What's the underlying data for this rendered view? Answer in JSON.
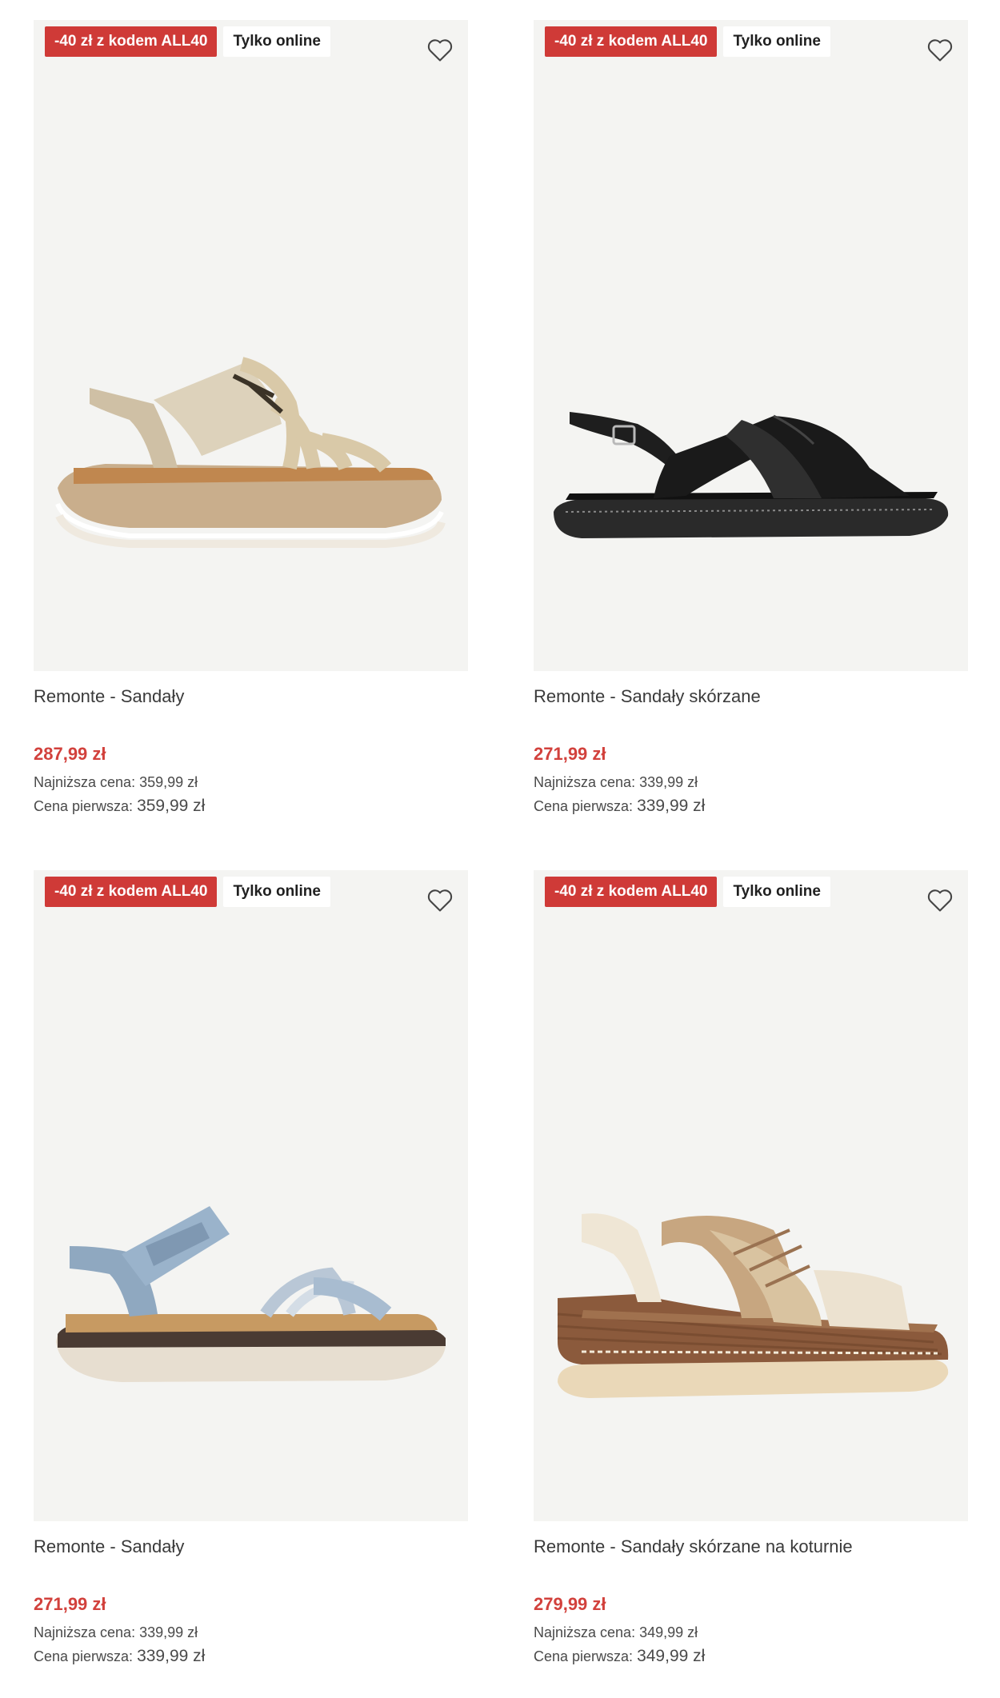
{
  "products": [
    {
      "promo_badge": "-40 zł z kodem ALL40",
      "online_badge": "Tylko online",
      "title": "Remonte - Sandały",
      "price": "287,99 zł",
      "lowest_label": "Najniższa cena:",
      "lowest_value": "359,99 zł",
      "first_label": "Cena pierwsza:",
      "first_value": "359,99 zł",
      "image": "beige-strappy-platform-sandal"
    },
    {
      "promo_badge": "-40 zł z kodem ALL40",
      "online_badge": "Tylko online",
      "title": "Remonte - Sandały skórzane",
      "price": "271,99 zł",
      "lowest_label": "Najniższa cena:",
      "lowest_value": "339,99 zł",
      "first_label": "Cena pierwsza:",
      "first_value": "339,99 zł",
      "image": "black-leather-crossover-sandal"
    },
    {
      "promo_badge": "-40 zł z kodem ALL40",
      "online_badge": "Tylko online",
      "title": "Remonte - Sandały",
      "price": "271,99 zł",
      "lowest_label": "Najniższa cena:",
      "lowest_value": "339,99 zł",
      "first_label": "Cena pierwsza:",
      "first_value": "339,99 zł",
      "image": "blue-velcro-sandal"
    },
    {
      "promo_badge": "-40 zł z kodem ALL40",
      "online_badge": "Tylko online",
      "title": "Remonte - Sandały skórzane na koturnie",
      "price": "279,99 zł",
      "lowest_label": "Najniższa cena:",
      "lowest_value": "349,99 zł",
      "first_label": "Cena pierwsza:",
      "first_value": "349,99 zł",
      "image": "cream-woven-wedge-sandal"
    }
  ],
  "colors": {
    "promo": "#cf3a37",
    "price": "#d2413c",
    "image_bg": "#f4f4f2"
  },
  "icons": {
    "favorite": "heart-outline-icon"
  }
}
